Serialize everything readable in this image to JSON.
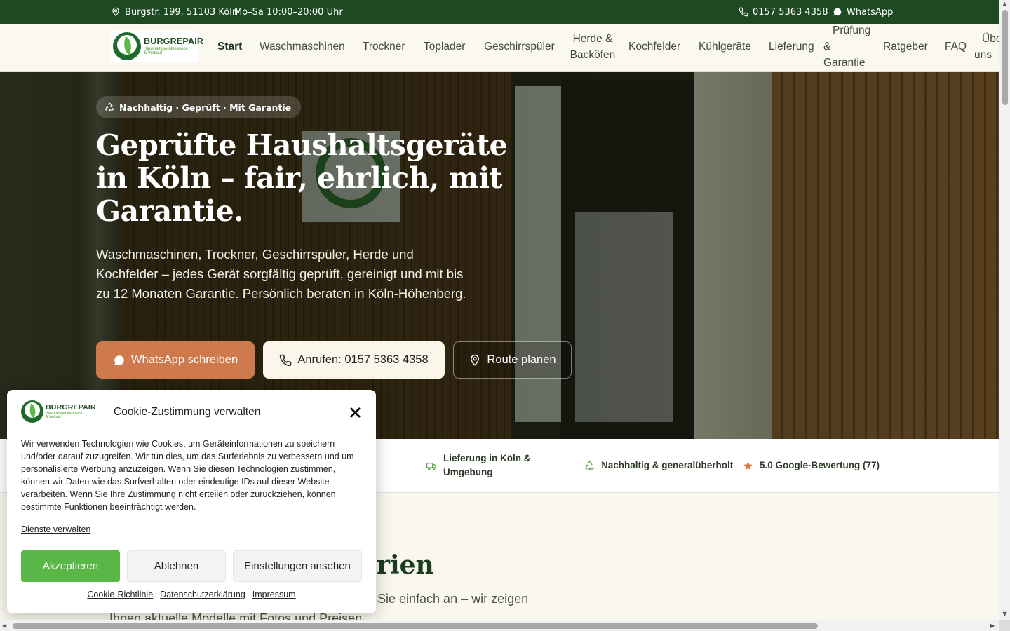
{
  "topbar": {
    "address": "Burgstr. 199, 51103 Köln",
    "hours": "Mo–Sa 10:00–20:00 Uhr",
    "phone": "0157 5363 4358",
    "whatsapp": "WhatsApp"
  },
  "logo": {
    "brand": "BURGREPAIR",
    "line1": "Haushaltsgeräteservice",
    "line2": "& Verkauf"
  },
  "nav": {
    "start": "Start",
    "waschmaschinen": "Waschmaschinen",
    "trockner": "Trockner",
    "toplader": "Toplader",
    "geschirrspueler": "Geschirrspüler",
    "herde_1": "Herde &",
    "herde_2": "Backöfen",
    "kochfelder": "Kochfelder",
    "kuehlgeraete": "Kühlgeräte",
    "lieferung": "Lieferung",
    "pruefung_1": "Prüfung",
    "pruefung_2": "&",
    "pruefung_3": "Garantie",
    "ratgeber": "Ratgeber",
    "faq": "FAQ",
    "ueber_1": "Über",
    "ueber_2": "uns"
  },
  "hero": {
    "badge": "Nachhaltig · Geprüft · Mit Garantie",
    "title": "Geprüfte Haushaltsgeräte in Köln – fair, ehrlich, mit Garantie.",
    "text": "Waschmaschinen, Trockner, Geschirrspüler, Herde und Kochfelder – jedes Gerät sorgfältig geprüft, gereinigt und mit bis zu 12 Monaten Garantie. Persönlich beraten in Köln-Höhenberg.",
    "btn_whatsapp": "WhatsApp schreiben",
    "btn_call": "Anrufen: 0157 5363 4358",
    "btn_route": "Route planen"
  },
  "trust": {
    "delivery_1": "Lieferung in Köln &",
    "delivery_2": "Umgebung",
    "sustainable": "Nachhaltig & generalüberholt",
    "rating": "5.0 Google-Bewertung (77)"
  },
  "section": {
    "title_visible": "rien",
    "text_visible_1": "Sie einfach an – wir zeigen",
    "text_visible_2": "Ihnen aktuelle Modelle mit Fotos und Preisen"
  },
  "cookie": {
    "title": "Cookie-Zustimmung verwalten",
    "body": "Wir verwenden Technologien wie Cookies, um Geräteinformationen zu speichern und/oder darauf zuzugreifen. Wir tun dies, um das Surferlebnis zu verbessern und um personalisierte Werbung anzuzeigen. Wenn Sie diesen Technologien zustimmen, können wir Daten wie das Surfverhalten oder eindeutige IDs auf dieser Website verarbeiten. Wenn Sie Ihre Zustimmung nicht erteilen oder zurückziehen, können bestimmte Funktionen beeinträchtigt werden.",
    "manage": "Dienste verwalten",
    "accept": "Akzeptieren",
    "deny": "Ablehnen",
    "settings": "Einstellungen ansehen",
    "link_policy": "Cookie-Richtlinie",
    "link_privacy": "Datenschutzerklärung",
    "link_imprint": "Impressum"
  },
  "colors": {
    "topbar": "#1d4a22",
    "accent": "#cf7a4d",
    "accept": "#5bb648",
    "heading": "#1d3b1f"
  },
  "icons": {
    "address": "map-pin-icon",
    "phone": "phone-icon",
    "whatsapp": "whatsapp-icon",
    "recycle": "recycle-icon",
    "truck": "truck-icon",
    "star": "star-icon",
    "close": "close-icon"
  }
}
